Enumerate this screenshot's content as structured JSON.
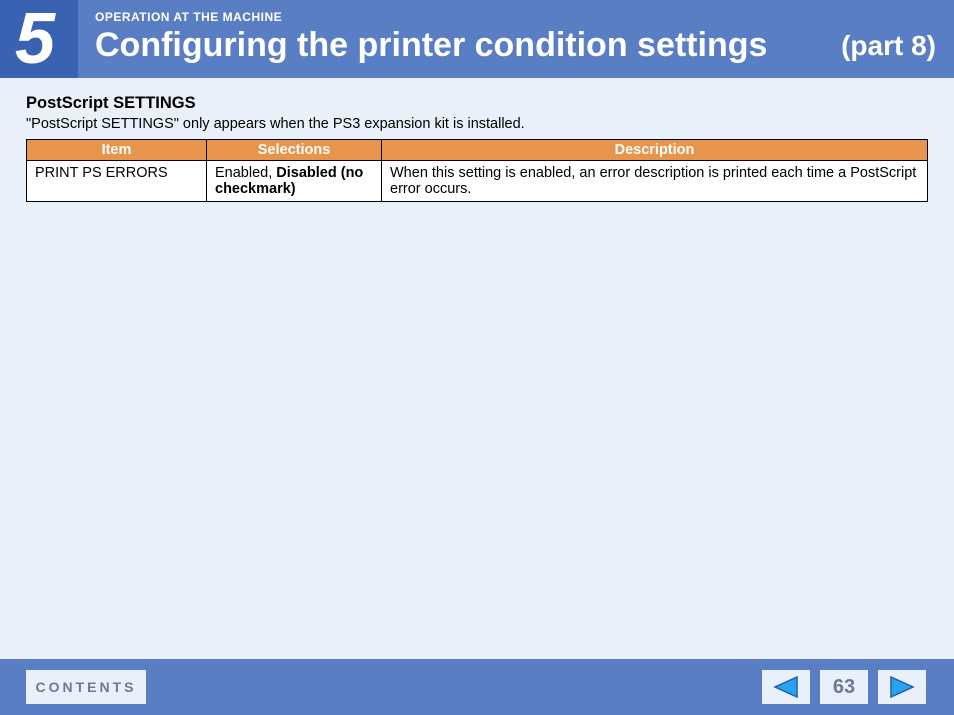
{
  "header": {
    "chapter_number": "5",
    "section_label": "OPERATION AT THE MACHINE",
    "title": "Configuring the printer condition settings",
    "part": "(part 8)"
  },
  "body": {
    "subheading": "PostScript SETTINGS",
    "note": "\"PostScript SETTINGS\" only appears when the PS3 expansion kit is installed.",
    "table": {
      "headers": {
        "item": "Item",
        "selections": "Selections",
        "description": "Description"
      },
      "rows": [
        {
          "item": "PRINT PS ERRORS",
          "selections_normal": "Enabled, ",
          "selections_bold": "Disabled (no checkmark)",
          "description": "When this setting is enabled, an error description is printed each time a PostScript error occurs."
        }
      ]
    }
  },
  "footer": {
    "contents_label": "CONTENTS",
    "page_number": "63"
  }
}
